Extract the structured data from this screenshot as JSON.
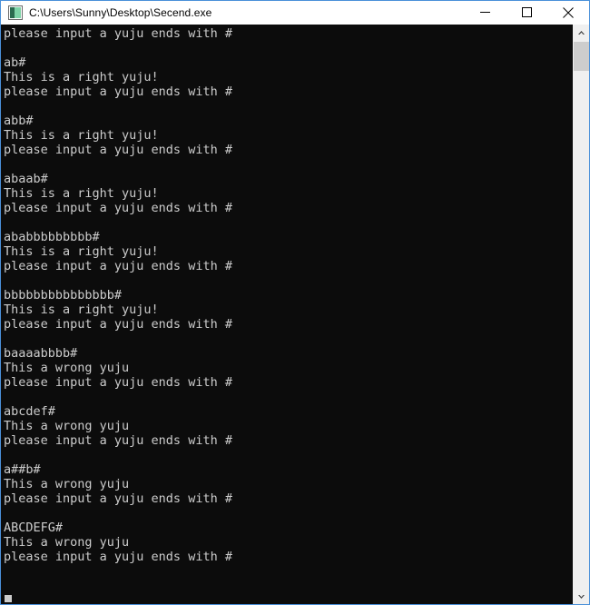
{
  "window": {
    "title": "C:\\Users\\Sunny\\Desktop\\Secend.exe",
    "icon": "console-app-icon",
    "border_color": "#4a90d9",
    "titlebar_bg": "#ffffff",
    "titlebar_fg": "#000000"
  },
  "caption_buttons": {
    "minimize": "minimize-icon",
    "maximize": "maximize-icon",
    "close": "close-icon"
  },
  "console": {
    "background": "#0c0c0c",
    "foreground": "#cccccc",
    "cursor": "block-cursor",
    "lines": [
      "please input a yuju ends with #",
      "",
      "ab#",
      "This is a right yuju!",
      "please input a yuju ends with #",
      "",
      "abb#",
      "This is a right yuju!",
      "please input a yuju ends with #",
      "",
      "abaab#",
      "This is a right yuju!",
      "please input a yuju ends with #",
      "",
      "ababbbbbbbbb#",
      "This is a right yuju!",
      "please input a yuju ends with #",
      "",
      "bbbbbbbbbbbbbbb#",
      "This is a right yuju!",
      "please input a yuju ends with #",
      "",
      "baaaabbbb#",
      "This a wrong yuju",
      "please input a yuju ends with #",
      "",
      "abcdef#",
      "This a wrong yuju",
      "please input a yuju ends with #",
      "",
      "a##b#",
      "This a wrong yuju",
      "please input a yuju ends with #",
      "",
      "ABCDEFG#",
      "This a wrong yuju",
      "please input a yuju ends with #",
      "",
      ""
    ]
  },
  "scrollbar": {
    "up_arrow": "chevron-up-icon",
    "down_arrow": "chevron-down-icon",
    "track_color": "#f0f0f0",
    "thumb_color": "#cdcdcd"
  }
}
